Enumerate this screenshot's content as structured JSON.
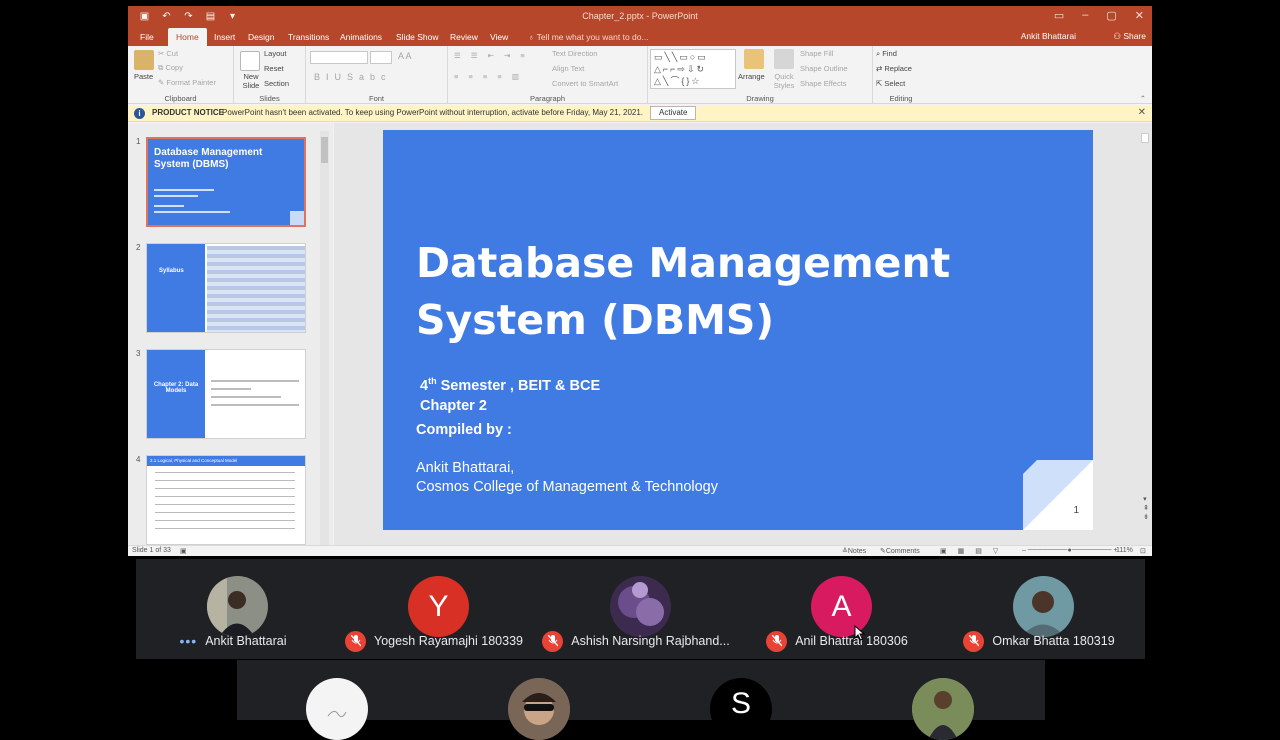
{
  "window": {
    "title": "Chapter_2.pptx - PowerPoint",
    "user": "Ankit Bhattarai",
    "share": "Share"
  },
  "menu": {
    "tabs": [
      "File",
      "Home",
      "Insert",
      "Design",
      "Transitions",
      "Animations",
      "Slide Show",
      "Review",
      "View"
    ],
    "active": "Home",
    "tell_me": "Tell me what you want to do..."
  },
  "ribbon": {
    "clipboard": {
      "label": "Clipboard",
      "paste": "Paste",
      "cut": "Cut",
      "copy": "Copy",
      "format_painter": "Format Painter"
    },
    "slides": {
      "label": "Slides",
      "new_slide": "New Slide",
      "layout": "Layout",
      "reset": "Reset",
      "section": "Section"
    },
    "font": {
      "label": "Font"
    },
    "paragraph": {
      "label": "Paragraph",
      "text_direction": "Text Direction",
      "align_text": "Align Text",
      "convert": "Convert to SmartArt"
    },
    "drawing": {
      "label": "Drawing",
      "arrange": "Arrange",
      "quick_styles": "Quick Styles",
      "shape_fill": "Shape Fill",
      "shape_outline": "Shape Outline",
      "shape_effects": "Shape Effects"
    },
    "editing": {
      "label": "Editing",
      "find": "Find",
      "replace": "Replace",
      "select": "Select"
    }
  },
  "notice": {
    "title": "PRODUCT NOTICE",
    "message": "PowerPoint hasn't been activated. To keep using PowerPoint without interruption, activate before Friday, May 21, 2021.",
    "button": "Activate"
  },
  "thumbnails": [
    {
      "num": "1",
      "title": "Database Management System (DBMS)"
    },
    {
      "num": "2",
      "title": "Syllabus"
    },
    {
      "num": "3",
      "title": "Chapter 2: Data Models"
    },
    {
      "num": "4",
      "title": "2.1 Logical, Physical and Conceptual Model"
    }
  ],
  "slide": {
    "title_line1": "Database Management",
    "title_line2": "System (DBMS)",
    "semester_num": "4",
    "semester_sup": "th",
    "semester_rest": " Semester , BEIT & BCE",
    "chapter": "Chapter 2",
    "compiled": "Compiled by :",
    "author": "Ankit Bhattarai,",
    "college": "Cosmos College of Management & Technology",
    "number": "1",
    "bg_color": "#3f7be3"
  },
  "status": {
    "slide_info": "Slide 1 of 33",
    "notes": "Notes",
    "comments": "Comments",
    "zoom": "111%"
  },
  "participants": [
    {
      "name": "Ankit Bhattarai",
      "muted": false
    },
    {
      "name": "Yogesh Rayamajhi 180339",
      "muted": true,
      "letter": "Y",
      "color": "#d93025"
    },
    {
      "name": "Ashish Narsingh Rajbhand...",
      "muted": true
    },
    {
      "name": "Anil Bhattrai 180306",
      "muted": true,
      "letter": "A",
      "color": "#d81b60"
    },
    {
      "name": "Omkar Bhatta 180319",
      "muted": true
    }
  ],
  "participants_row2": [
    {
      "letter": "S"
    }
  ]
}
